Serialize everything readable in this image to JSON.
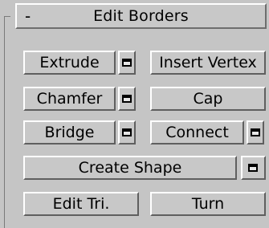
{
  "rollout": {
    "collapse_symbol": "-",
    "title": "Edit Borders"
  },
  "buttons": {
    "extrude": "Extrude",
    "insert_vertex": "Insert Vertex",
    "chamfer": "Chamfer",
    "cap": "Cap",
    "bridge": "Bridge",
    "connect": "Connect",
    "create_shape": "Create Shape",
    "edit_tri": "Edit Tri.",
    "turn": "Turn"
  },
  "icons": {
    "settings": "settings-window-icon"
  }
}
